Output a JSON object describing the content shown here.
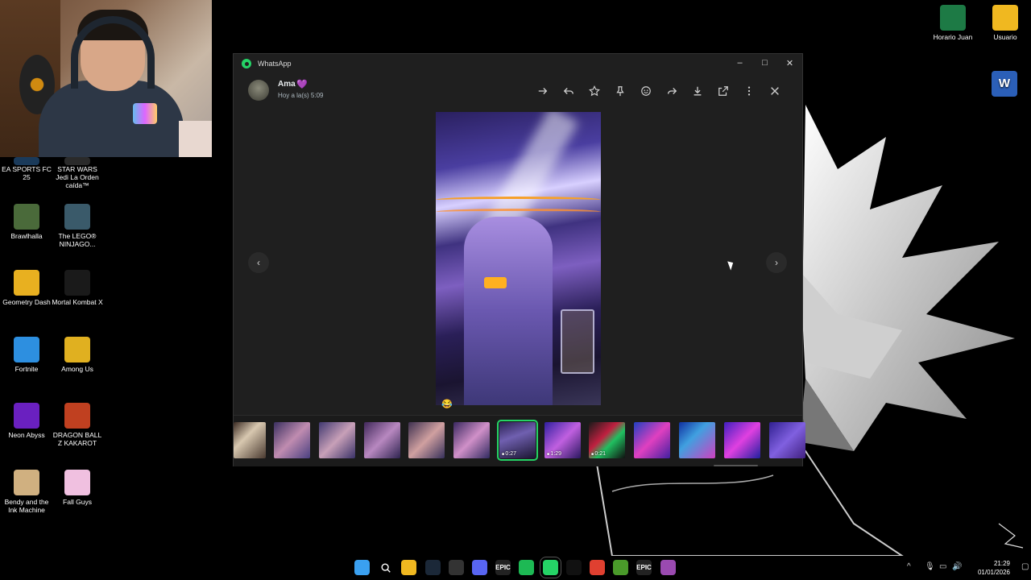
{
  "desktop": {
    "icons_left": [
      {
        "label": "EA SPORTS FC 25",
        "icon": "ea-fc-icon",
        "color": "#1a3a5a"
      },
      {
        "label": "STAR WARS Jedi La Orden caída™",
        "icon": "star-wars-icon",
        "color": "#2a2a2a"
      },
      {
        "label": "Brawlhalla",
        "icon": "brawlhalla-icon",
        "color": "#4a6a3a"
      },
      {
        "label": "The LEGO® NINJAGO...",
        "icon": "lego-ninjago-icon",
        "color": "#3a5a6a"
      },
      {
        "label": "Geometry Dash",
        "icon": "geometry-dash-icon",
        "color": "#e8b020"
      },
      {
        "label": "Mortal Kombat X",
        "icon": "mortal-kombat-icon",
        "color": "#1a1a1a"
      },
      {
        "label": "Fortnite",
        "icon": "fortnite-icon",
        "color": "#2d8fe0"
      },
      {
        "label": "Among Us",
        "icon": "among-us-icon",
        "color": "#e0b020"
      },
      {
        "label": "Neon Abyss",
        "icon": "neon-abyss-icon",
        "color": "#6a20c0"
      },
      {
        "label": "DRAGON BALL Z KAKAROT",
        "icon": "dragon-ball-icon",
        "color": "#c04020"
      },
      {
        "label": "Bendy and the Ink Machine",
        "icon": "bendy-icon",
        "color": "#d0b080"
      },
      {
        "label": "Fall Guys",
        "icon": "fall-guys-icon",
        "color": "#f0c0e0"
      }
    ],
    "icons_right": [
      {
        "label": "Horario Juan",
        "icon": "excel-icon",
        "color": "#1d7a45"
      },
      {
        "label": "Usuario",
        "icon": "folder-icon",
        "color": "#f0b820"
      }
    ],
    "word_icon": {
      "icon": "word-icon",
      "color": "#2b5fb8"
    }
  },
  "window": {
    "app_title": "WhatsApp",
    "controls": {
      "minimize": "–",
      "maximize": "□",
      "close": "✕"
    },
    "contact": {
      "name": "Ama",
      "heart": "💜",
      "time": "Hoy a la(s) 5:09"
    },
    "toolbar": [
      {
        "icon": "go-to-message-icon"
      },
      {
        "icon": "reply-icon"
      },
      {
        "icon": "star-icon"
      },
      {
        "icon": "pin-icon"
      },
      {
        "icon": "emoji-react-icon"
      },
      {
        "icon": "forward-icon"
      },
      {
        "icon": "download-icon"
      },
      {
        "icon": "open-external-icon"
      },
      {
        "icon": "more-options-icon"
      },
      {
        "icon": "close-viewer-icon"
      }
    ],
    "prev_arrow": "‹",
    "next_arrow": "›",
    "reaction": "😂",
    "thumbnails": [
      {
        "duration": "",
        "selected": false,
        "bg": "linear-gradient(135deg,#3a2a22,#d8c8b0 40%,#4a3a30)"
      },
      {
        "duration": "",
        "selected": false,
        "bg": "linear-gradient(135deg,#3a3060,#c08cb0 50%,#4a4080)"
      },
      {
        "duration": "",
        "selected": false,
        "bg": "linear-gradient(135deg,#403870,#c8a0b8 50%,#3a3268)"
      },
      {
        "duration": "",
        "selected": false,
        "bg": "linear-gradient(135deg,#40285a,#b888c0 50%,#2e2450)"
      },
      {
        "duration": "",
        "selected": false,
        "bg": "linear-gradient(135deg,#3e3050,#d0a0a0 50%,#36305a)"
      },
      {
        "duration": "",
        "selected": false,
        "bg": "linear-gradient(135deg,#3a2860,#d090c8 50%,#302a60)"
      },
      {
        "duration": "0:27",
        "selected": true,
        "bg": "linear-gradient(160deg,#2a2050,#7060b0 40%,#1a1430)"
      },
      {
        "duration": "1:29",
        "selected": false,
        "bg": "linear-gradient(135deg,#3020a0,#c060e0 50%,#2a1860)"
      },
      {
        "duration": "0:21",
        "selected": false,
        "bg": "linear-gradient(135deg,#1a1a1a,#c02040 40%,#20c060 60%,#101010)"
      },
      {
        "duration": "",
        "selected": false,
        "bg": "linear-gradient(135deg,#2040c0,#e040c0 50%,#4020a0)"
      },
      {
        "duration": "",
        "selected": false,
        "bg": "linear-gradient(135deg,#1030a0,#40a0e0 40%,#d040c0)"
      },
      {
        "duration": "",
        "selected": false,
        "bg": "linear-gradient(135deg,#4020c0,#e040e0 50%,#2020a0)"
      },
      {
        "duration": "",
        "selected": false,
        "bg": "linear-gradient(135deg,#302090,#8060e0 50%,#402080)"
      }
    ]
  },
  "taskbar": {
    "apps": [
      {
        "icon": "start-menu-icon",
        "label": "",
        "color": "#3aa0f0"
      },
      {
        "icon": "search-icon",
        "label": "",
        "color": "transparent"
      },
      {
        "icon": "file-explorer-icon",
        "label": "",
        "color": "#f0b820"
      },
      {
        "icon": "steam-icon",
        "label": "",
        "color": "#1b2838"
      },
      {
        "icon": "gpu-settings-icon",
        "label": "",
        "color": "#333"
      },
      {
        "icon": "discord-icon",
        "label": "",
        "color": "#5865f2"
      },
      {
        "icon": "epic-games-icon",
        "label": "EPIC",
        "color": "#222"
      },
      {
        "icon": "spotify-icon",
        "label": "",
        "color": "#1db954"
      },
      {
        "icon": "whatsapp-icon",
        "label": "",
        "color": "#25d366"
      },
      {
        "icon": "capcut-icon",
        "label": "",
        "color": "#111"
      },
      {
        "icon": "chrome-icon",
        "label": "",
        "color": "#e04030"
      },
      {
        "icon": "minecraft-icon",
        "label": "",
        "color": "#4a9a2a"
      },
      {
        "icon": "epic-games-2-icon",
        "label": "EPIC",
        "color": "#222"
      },
      {
        "icon": "fall-guys-taskbar-icon",
        "label": "",
        "color": "#9a4ab0"
      }
    ],
    "tray": {
      "chevron": "^",
      "time": "21:29",
      "date": "01/01/2026"
    }
  }
}
